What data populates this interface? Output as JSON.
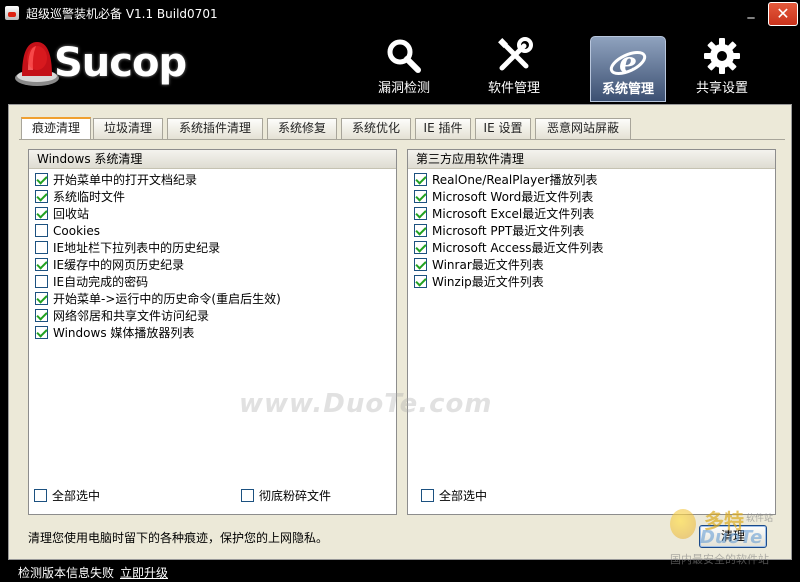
{
  "window": {
    "title": "超级巡警装机必备 V1.1 Build0701",
    "minimize_label": "_",
    "close_label": "✕"
  },
  "header": {
    "logo_text": "Sucop",
    "nav": [
      {
        "label": "漏洞检测",
        "icon": "magnifier-icon"
      },
      {
        "label": "软件管理",
        "icon": "tools-icon"
      },
      {
        "label": "系统管理",
        "icon": "ie-globe-icon",
        "active": true
      },
      {
        "label": "共享设置",
        "icon": "gear-icon"
      }
    ]
  },
  "tabs": [
    {
      "label": "痕迹清理",
      "active": true
    },
    {
      "label": "垃圾清理"
    },
    {
      "label": "系统插件清理"
    },
    {
      "label": "系统修复"
    },
    {
      "label": "系统优化"
    },
    {
      "label": "IE 插件"
    },
    {
      "label": "IE 设置"
    },
    {
      "label": "恶意网站屏蔽"
    }
  ],
  "left_panel": {
    "header": "Windows 系统清理",
    "items": [
      {
        "label": "开始菜单中的打开文档纪录",
        "checked": true
      },
      {
        "label": "系统临时文件",
        "checked": true
      },
      {
        "label": "回收站",
        "checked": true
      },
      {
        "label": "Cookies",
        "checked": false
      },
      {
        "label": "IE地址栏下拉列表中的历史纪录",
        "checked": false
      },
      {
        "label": "IE缓存中的网页历史纪录",
        "checked": true
      },
      {
        "label": "IE自动完成的密码",
        "checked": false
      },
      {
        "label": "开始菜单->运行中的历史命令(重启后生效)",
        "checked": true
      },
      {
        "label": "网络邻居和共享文件访问纪录",
        "checked": true
      },
      {
        "label": "Windows 媒体播放器列表",
        "checked": true
      }
    ],
    "select_all_label": "全部选中",
    "shred_label": "彻底粉碎文件"
  },
  "right_panel": {
    "header": "第三方应用软件清理",
    "items": [
      {
        "label": "RealOne/RealPlayer播放列表",
        "checked": true
      },
      {
        "label": "Microsoft Word最近文件列表",
        "checked": true
      },
      {
        "label": "Microsoft Excel最近文件列表",
        "checked": true
      },
      {
        "label": "Microsoft PPT最近文件列表",
        "checked": true
      },
      {
        "label": "Microsoft Access最近文件列表",
        "checked": true
      },
      {
        "label": "Winrar最近文件列表",
        "checked": true
      },
      {
        "label": "Winzip最近文件列表",
        "checked": true
      }
    ],
    "select_all_label": "全部选中"
  },
  "description": "清理您使用电脑时留下的各种痕迹，保护您的上网隐私。",
  "clean_button": "清理",
  "status": {
    "text": "检测版本信息失败",
    "link": "立即升级"
  },
  "watermark": "www.DuoTe.com",
  "corner_watermark": {
    "big": "多特",
    "sub": "软件站",
    "logo": "DuoTe",
    "tag": "国内最安全的软件站"
  },
  "colors": {
    "active_tab_accent": "#f0a030",
    "check_mark": "#21a121",
    "nav_active_bg": "#5b6e91"
  }
}
